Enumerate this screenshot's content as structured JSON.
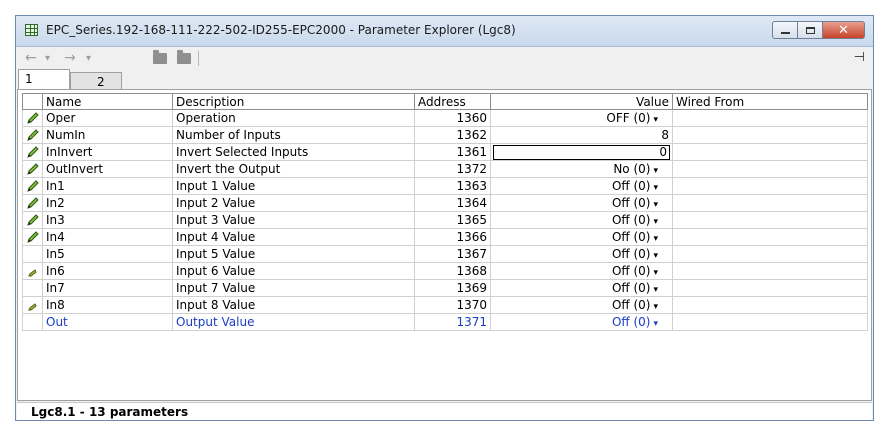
{
  "window": {
    "title": "EPC_Series.192-168-111-222-502-ID255-EPC2000 - Parameter Explorer (Lgc8)",
    "close_glyph": "✕"
  },
  "toolbar": {
    "icons": [
      "back-arrow-icon",
      "dropdown-icon",
      "forward-arrow-icon",
      "dropdown-icon",
      "folder-icon",
      "folder-icon",
      "pin-icon"
    ],
    "back_glyph": "←",
    "forward_glyph": "→",
    "dropdown_glyph": "▾",
    "pin_glyph": "⊣"
  },
  "tabs": [
    {
      "label": "1",
      "active": true
    },
    {
      "label": "2",
      "active": false
    }
  ],
  "table": {
    "columns": [
      "Name",
      "Description",
      "Address",
      "Value",
      "Wired From"
    ],
    "rows": [
      {
        "icon": "pencil-icon",
        "name": "Oper",
        "description": "Operation",
        "address": "1360",
        "value": "OFF (0)",
        "dropdown": true,
        "wired_from": ""
      },
      {
        "icon": "pencil-icon",
        "name": "NumIn",
        "description": "Number of Inputs",
        "address": "1362",
        "value": "8",
        "dropdown": false,
        "wired_from": ""
      },
      {
        "icon": "pencil-icon",
        "name": "InInvert",
        "description": "Invert Selected Inputs",
        "address": "1361",
        "value": "0",
        "dropdown": false,
        "editing": true,
        "wired_from": ""
      },
      {
        "icon": "pencil-icon",
        "name": "OutInvert",
        "description": "Invert the Output",
        "address": "1372",
        "value": "No (0)",
        "dropdown": true,
        "wired_from": ""
      },
      {
        "icon": "pencil-icon",
        "name": "In1",
        "description": "Input 1 Value",
        "address": "1363",
        "value": "Off (0)",
        "dropdown": true,
        "wired_from": ""
      },
      {
        "icon": "pencil-icon",
        "name": "In2",
        "description": "Input 2 Value",
        "address": "1364",
        "value": "Off (0)",
        "dropdown": true,
        "wired_from": ""
      },
      {
        "icon": "pencil-icon",
        "name": "In3",
        "description": "Input 3 Value",
        "address": "1365",
        "value": "Off (0)",
        "dropdown": true,
        "wired_from": ""
      },
      {
        "icon": "pencil-icon",
        "name": "In4",
        "description": "Input 4 Value",
        "address": "1366",
        "value": "Off (0)",
        "dropdown": true,
        "wired_from": ""
      },
      {
        "icon": "",
        "name": "In5",
        "description": "Input 5 Value",
        "address": "1367",
        "value": "Off (0)",
        "dropdown": true,
        "wired_from": ""
      },
      {
        "icon": "small-pencil-icon",
        "name": "In6",
        "description": "Input 6 Value",
        "address": "1368",
        "value": "Off (0)",
        "dropdown": true,
        "wired_from": ""
      },
      {
        "icon": "",
        "name": "In7",
        "description": "Input 7 Value",
        "address": "1369",
        "value": "Off (0)",
        "dropdown": true,
        "wired_from": ""
      },
      {
        "icon": "small-pencil-icon",
        "name": "In8",
        "description": "Input 8 Value",
        "address": "1370",
        "value": "Off (0)",
        "dropdown": true,
        "wired_from": ""
      },
      {
        "icon": "",
        "name": "Out",
        "description": "Output Value",
        "address": "1371",
        "value": "Off (0)",
        "dropdown": true,
        "wired_from": "",
        "highlight": "blue"
      }
    ]
  },
  "status": {
    "text": "Lgc8.1  -  13 parameters"
  },
  "colors": {
    "pencil": "#6aa82c",
    "output_row": "#1a3cc8",
    "title_gradient": "#dfe9f5"
  }
}
